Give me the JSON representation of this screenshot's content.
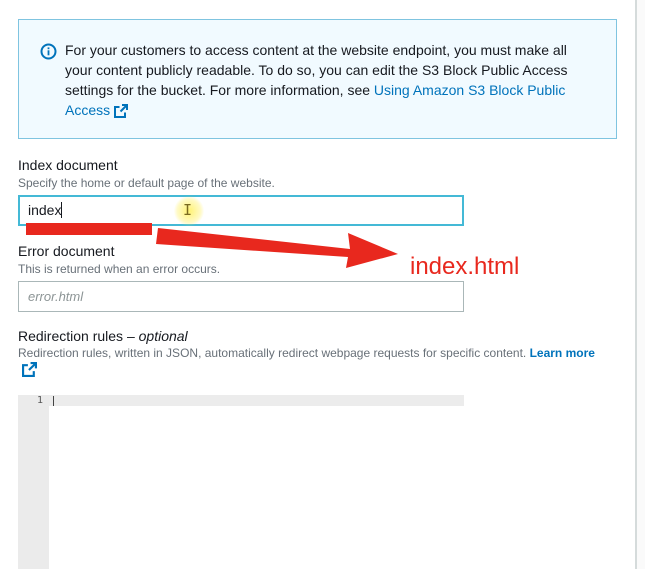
{
  "alert": {
    "text": "For your customers to access content at the website endpoint, you must make all your content publicly readable. To do so, you can edit the S3 Block Public Access settings for the bucket. For more information, see ",
    "link_label": "Using Amazon S3 Block Public Access",
    "icon": "info-icon",
    "link_icon": "external-link-icon"
  },
  "index_document": {
    "label": "Index document",
    "description": "Specify the home or default page of the website.",
    "value": "index"
  },
  "error_document": {
    "label": "Error document",
    "description": "This is returned when an error occurs.",
    "placeholder": "error.html"
  },
  "redirection_rules": {
    "label": "Redirection rules –",
    "label_optional": "optional",
    "description": "Redirection rules, written in JSON, automatically redirect webpage requests for specific content.",
    "learn_more": "Learn more",
    "editor_line_number": "1"
  },
  "annotation": {
    "text": "index.html",
    "color": "#e8281e"
  },
  "colors": {
    "link": "#0073bb",
    "alert_border": "#7fc4e0",
    "alert_bg": "#f1faff",
    "focus_border": "#44b9d6"
  }
}
